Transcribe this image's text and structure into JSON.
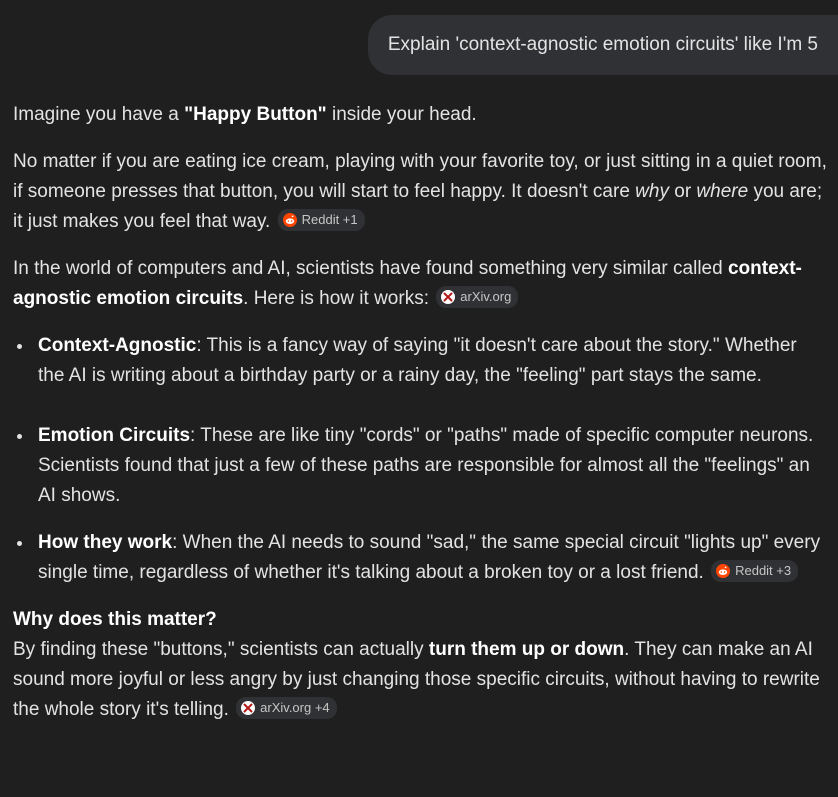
{
  "user_prompt": "Explain 'context-agnostic emotion circuits' like I'm 5",
  "p1": {
    "pre": "Imagine you have a ",
    "bold": "\"Happy Button\"",
    "post": " inside your head."
  },
  "p2": {
    "t1": "No matter if you are eating ice cream, playing with your favorite toy, or just sitting in a quiet room, if someone presses that button, you will start to feel happy. It doesn't care ",
    "i1": "why",
    "t2": " or ",
    "i2": "where",
    "t3": " you are; it just makes you feel that way. ",
    "chip": {
      "icon": "reddit-icon",
      "label": "Reddit +1"
    }
  },
  "p3": {
    "t1": "In the world of computers and AI, scientists have found something very similar called ",
    "bold": "context-agnostic emotion circuits",
    "t2": ". Here is how it works: ",
    "chip": {
      "icon": "arxiv-icon",
      "label": "arXiv.org"
    }
  },
  "bullets": [
    {
      "bold": "Context-Agnostic",
      "text": ": This is a fancy way of saying \"it doesn't care about the story.\" Whether the AI is writing about a birthday party or a rainy day, the \"feeling\" part stays the same."
    },
    {
      "bold": "Emotion Circuits",
      "text": ": These are like tiny \"cords\" or \"paths\" made of specific computer neurons. Scientists found that just a few of these paths are responsible for almost all the \"feelings\" an AI shows."
    },
    {
      "bold": "How they work",
      "text": ": When the AI needs to sound \"sad,\" the same special circuit \"lights up\" every single time, regardless of whether it's talking about a broken toy or a lost friend. ",
      "chip": {
        "icon": "reddit-icon",
        "label": "Reddit +3"
      }
    }
  ],
  "why": {
    "title": "Why does this matter?",
    "t1": "By finding these \"buttons,\" scientists can actually ",
    "bold": "turn them up or down",
    "t2": ". They can make an AI sound more joyful or less angry by just changing those specific circuits, without having to rewrite the whole story it's telling. ",
    "chip": {
      "icon": "arxiv-icon",
      "label": "arXiv.org +4"
    }
  },
  "colors": {
    "background": "#1f1f1f",
    "bubble": "#303134",
    "text": "#e3e3e3",
    "reddit": "#ff4500",
    "arxiv": "#b31b1b"
  }
}
